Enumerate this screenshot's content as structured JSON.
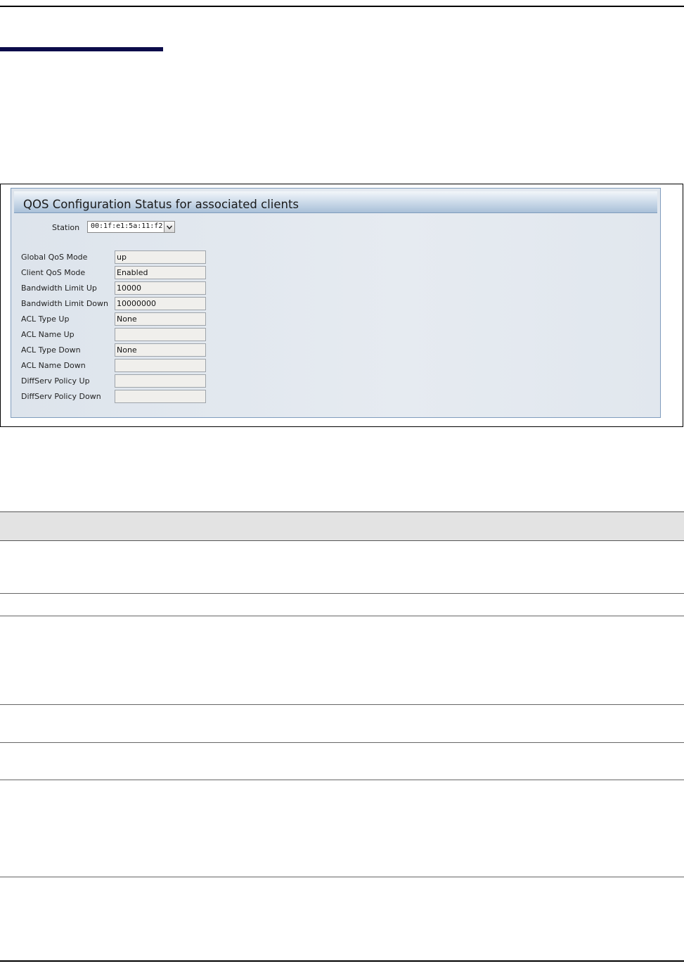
{
  "panel": {
    "title": "QOS Configuration Status for associated clients",
    "station_label": "Station",
    "station_value": "00:1f:e1:5a:11:f2"
  },
  "fields": [
    {
      "label": "Global QoS Mode",
      "value": "up"
    },
    {
      "label": "Client QoS Mode",
      "value": "Enabled"
    },
    {
      "label": "Bandwidth Limit Up",
      "value": "10000"
    },
    {
      "label": "Bandwidth Limit Down",
      "value": "10000000"
    },
    {
      "label": "ACL Type Up",
      "value": "None"
    },
    {
      "label": "ACL Name Up",
      "value": ""
    },
    {
      "label": "ACL Type Down",
      "value": "None"
    },
    {
      "label": "ACL Name Down",
      "value": ""
    },
    {
      "label": "DiffServ Policy Up",
      "value": ""
    },
    {
      "label": "DiffServ Policy Down",
      "value": ""
    }
  ],
  "colors": {
    "accent_bar": "#0c0c4a",
    "panel_border": "#7f9cbd",
    "table_header": "#e3e3e3"
  }
}
